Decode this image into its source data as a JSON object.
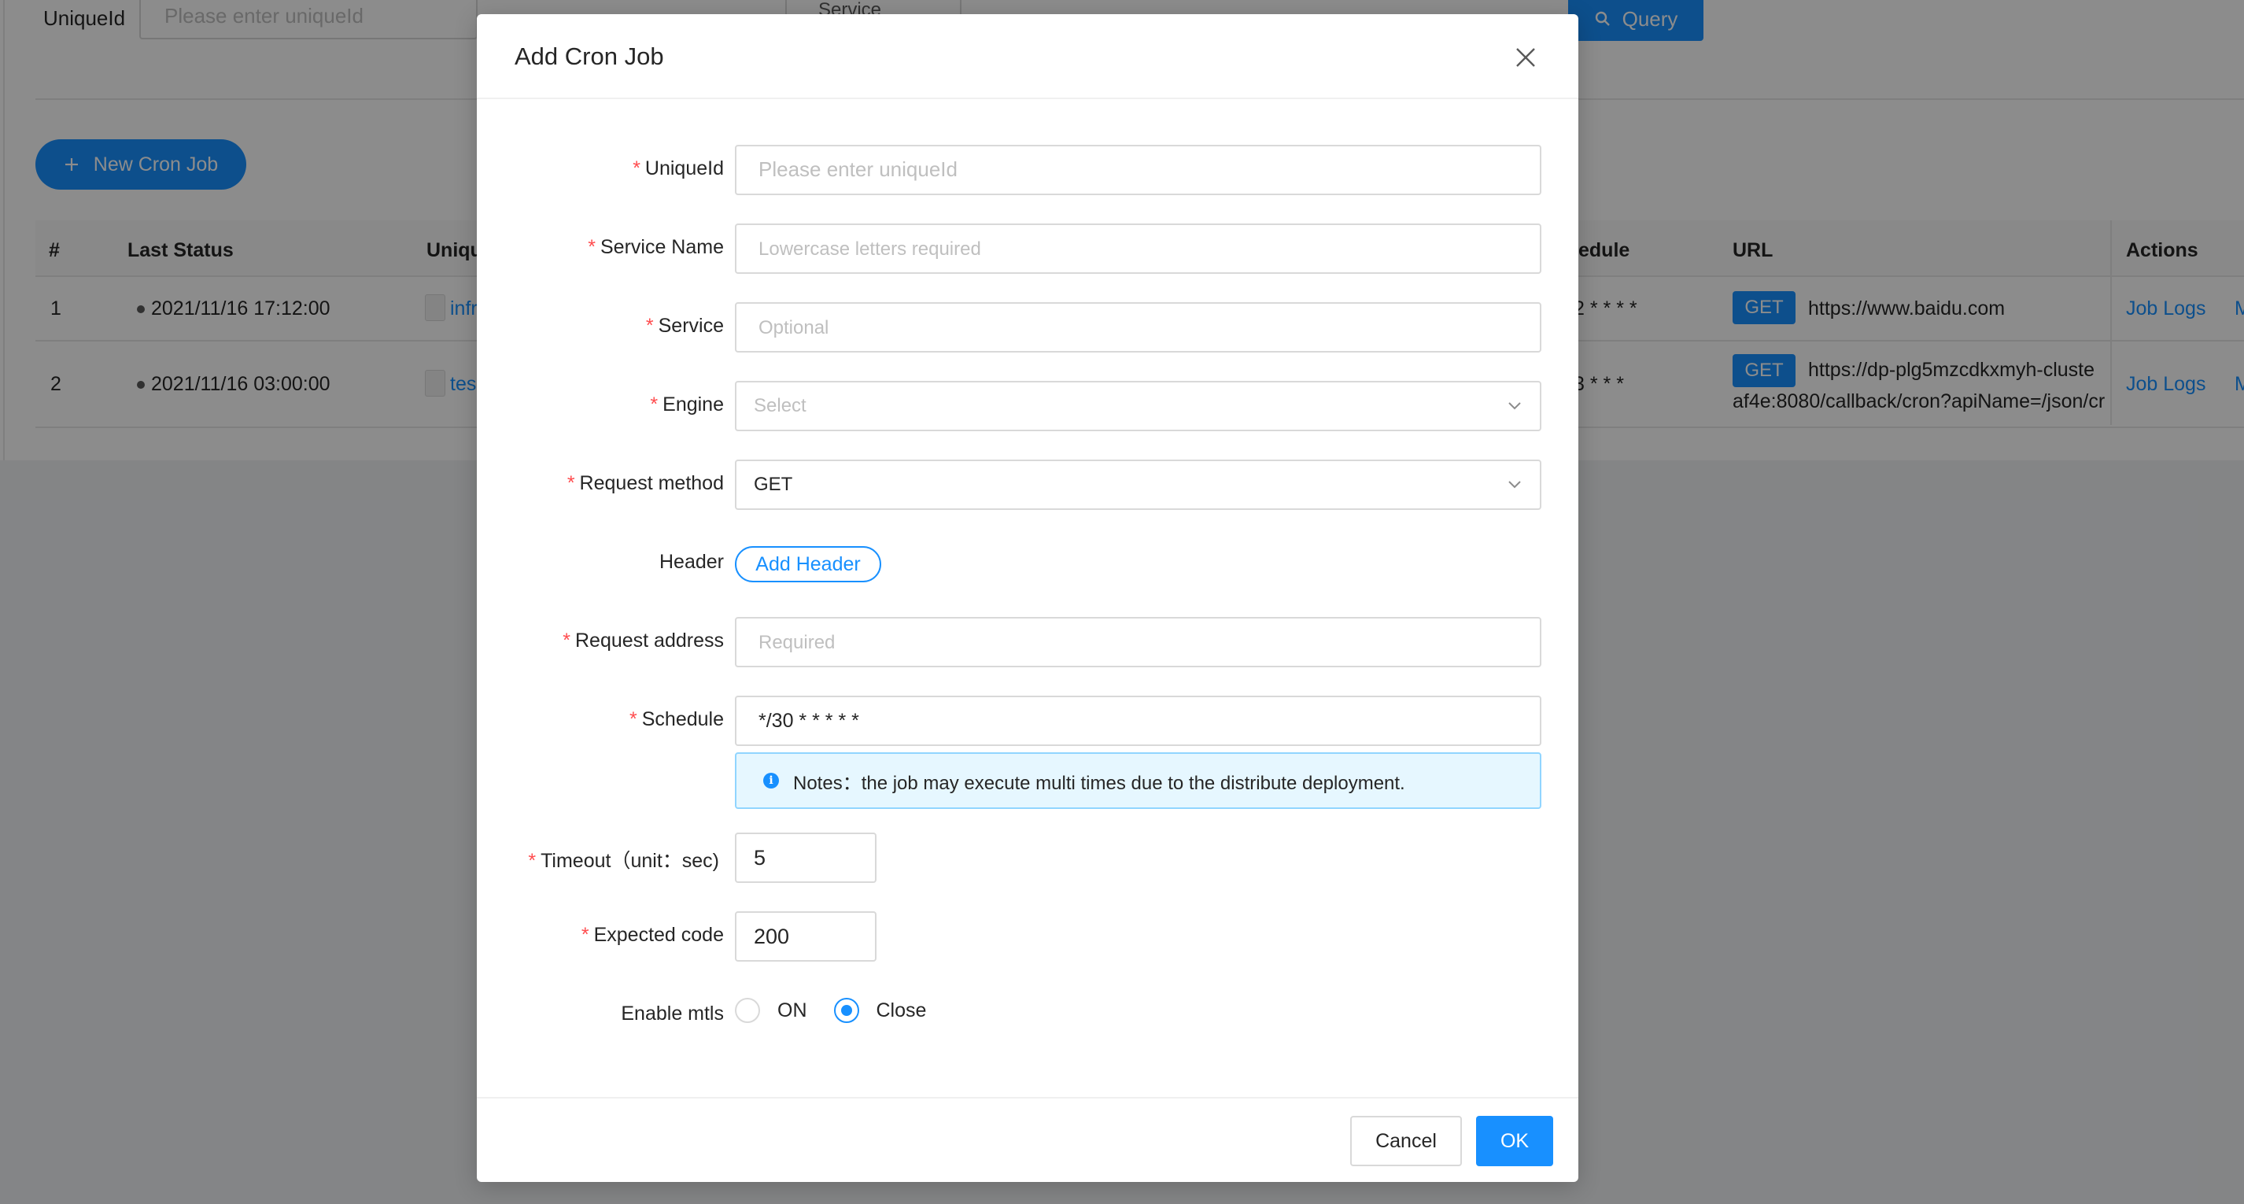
{
  "background": {
    "filter": {
      "uniqueid_label": "UniqueId",
      "uniqueid_placeholder": "Please enter uniqueId",
      "service_name_label": "Service Name",
      "query_button": "Query"
    },
    "new_job_button": "New Cron Job",
    "table": {
      "headers": [
        "#",
        "Last Status",
        "Uniqu",
        "edule",
        "URL",
        "Actions"
      ],
      "rows": [
        {
          "index": "1",
          "last_status": "2021/11/16 17:12:00",
          "uniqueid": "infr",
          "schedule": "2 * * * *",
          "method": "GET",
          "url": "https://www.baidu.com",
          "url_line2": "",
          "action": "Job Logs",
          "action2": "M"
        },
        {
          "index": "2",
          "last_status": "2021/11/16 03:00:00",
          "uniqueid": "tes",
          "schedule": "3 * * *",
          "method": "GET",
          "url": "https://dp-plg5mzcdkxmyh-cluste",
          "url_line2": "af4e:8080/callback/cron?apiName=/json/cr",
          "action": "Job Logs",
          "action2": "M"
        }
      ]
    }
  },
  "modal": {
    "title": "Add Cron Job",
    "fields": {
      "uniqueid": {
        "label": "UniqueId",
        "placeholder": "Please enter uniqueId",
        "value": ""
      },
      "service_name": {
        "label": "Service Name",
        "placeholder": "Lowercase letters required",
        "value": ""
      },
      "service": {
        "label": "Service",
        "placeholder": "Optional",
        "value": ""
      },
      "engine": {
        "label": "Engine",
        "placeholder": "Select"
      },
      "request_method": {
        "label": "Request method",
        "value": "GET"
      },
      "header": {
        "label": "Header",
        "button": "Add Header"
      },
      "request_address": {
        "label": "Request address",
        "placeholder": "Required",
        "value": ""
      },
      "schedule": {
        "label": "Schedule",
        "value": "*/30 * * * * *",
        "notice": "Notes：the job may execute multi times due to the distribute deployment."
      },
      "timeout": {
        "label": "Timeout（unit：sec)",
        "value": "5"
      },
      "expected_code": {
        "label": "Expected code",
        "value": "200"
      },
      "enable_mtls": {
        "label": "Enable mtls",
        "options": [
          "ON",
          "Close"
        ],
        "selected": "Close"
      }
    },
    "footer": {
      "cancel": "Cancel",
      "ok": "OK"
    }
  },
  "colors": {
    "primary": "#1890ff",
    "required": "#ff4d4f",
    "notice_bg": "#e6f7ff",
    "mask": "rgba(0,0,0,0.45)"
  },
  "icons": [
    "search-icon",
    "plus-icon",
    "close-icon",
    "chevron-down-icon",
    "info-icon"
  ]
}
